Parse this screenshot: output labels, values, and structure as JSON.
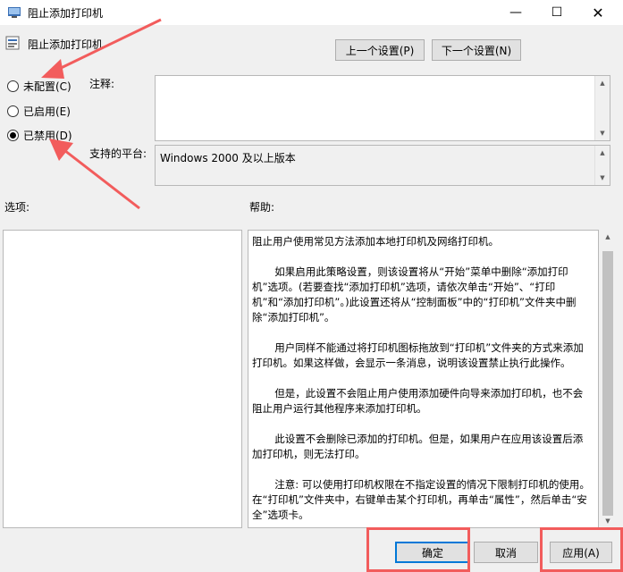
{
  "window": {
    "title": "阻止添加打印机",
    "controls": {
      "minimize": "—",
      "maximize": "☐",
      "close": "✕"
    }
  },
  "header": {
    "title": "阻止添加打印机",
    "prev_button": "上一个设置(P)",
    "next_button": "下一个设置(N)"
  },
  "state": {
    "options": [
      {
        "label": "未配置(C)",
        "selected": false
      },
      {
        "label": "已启用(E)",
        "selected": false
      },
      {
        "label": "已禁用(D)",
        "selected": true
      }
    ]
  },
  "fields": {
    "comment_label": "注释:",
    "comment_value": "",
    "platform_label": "支持的平台:",
    "platform_value": "Windows 2000 及以上版本"
  },
  "panes": {
    "options_label": "选项:",
    "help_label": "帮助:",
    "help_paragraphs": [
      "阻止用户使用常见方法添加本地打印机及网络打印机。",
      "如果启用此策略设置，则该设置将从“开始”菜单中删除“添加打印机”选项。(若要查找“添加打印机”选项，请依次单击“开始”、“打印机”和“添加打印机”。)此设置还将从“控制面板”中的“打印机”文件夹中删除“添加打印机”。",
      "用户同样不能通过将打印机图标拖放到“打印机”文件夹的方式来添加打印机。如果这样做，会显示一条消息，说明该设置禁止执行此操作。",
      "但是，此设置不会阻止用户使用添加硬件向导来添加打印机，也不会阻止用户运行其他程序来添加打印机。",
      "此设置不会删除已添加的打印机。但是，如果用户在应用该设置后添加打印机，则无法打印。",
      "注意: 可以使用打印机权限在不指定设置的情况下限制打印机的使用。在“打印机”文件夹中，右键单击某个打印机，再单击“属性”，然后单击“安全”选项卡。"
    ]
  },
  "footer": {
    "ok": "确定",
    "cancel": "取消",
    "apply": "应用(A)"
  },
  "colors": {
    "annotation": "#f25c5c",
    "focus_border": "#0078d7"
  },
  "icons": {
    "app": "policy-window-icon",
    "heading": "policy-setting-icon"
  }
}
